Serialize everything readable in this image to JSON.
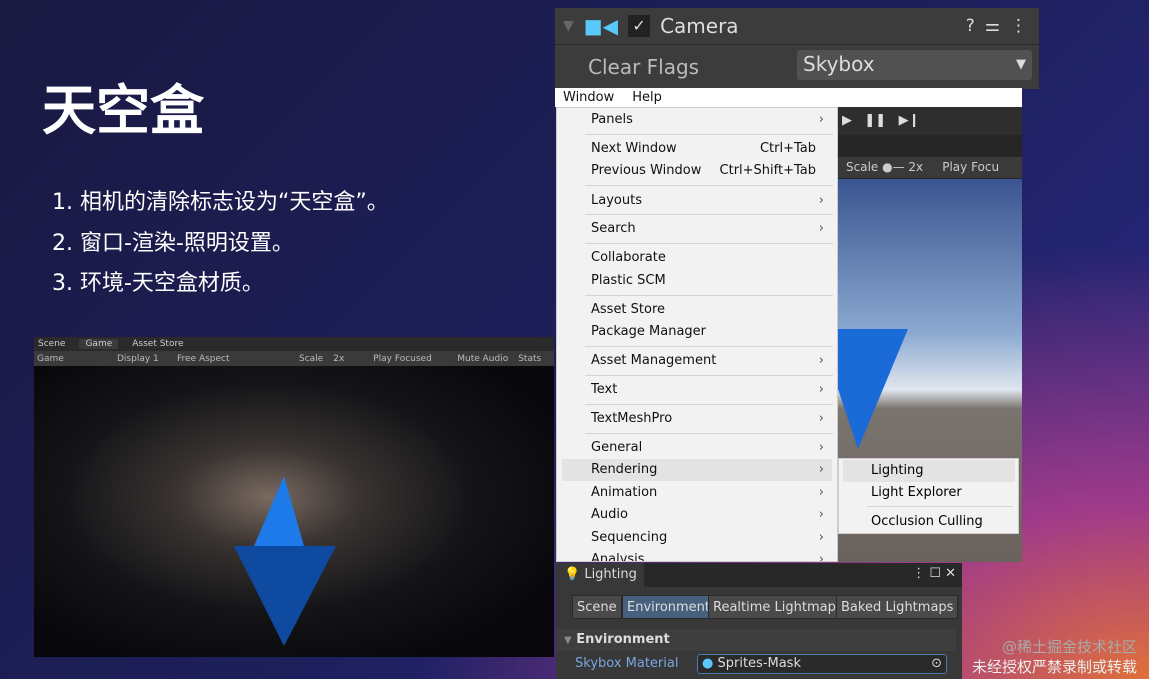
{
  "slide": {
    "title": "天空盒",
    "steps": [
      "1. 相机的清除标志设为“天空盒”。",
      "2. 窗口-渲染-照明设置。",
      "3. 环境-天空盒材质。"
    ]
  },
  "game_view": {
    "tabs": [
      "Scene",
      "Game",
      "Asset Store"
    ],
    "toolbar": [
      "Game",
      "Display 1",
      "Free Aspect",
      "Scale",
      "2x",
      "Play Focused",
      "Mute Audio",
      "Stats"
    ]
  },
  "inspector": {
    "component": "Camera",
    "clear_flags_label": "Clear Flags",
    "clear_flags_value": "Skybox",
    "accent": "#5ac8fa"
  },
  "menubar": [
    "Window",
    "Help"
  ],
  "editor_bg": {
    "scale": "Scale",
    "zoom": "2x",
    "play": "Play Focu"
  },
  "menu": [
    {
      "label": "Panels",
      "arrow": true
    },
    {
      "label": "Next Window",
      "shortcut": "Ctrl+Tab"
    },
    {
      "label": "Previous Window",
      "shortcut": "Ctrl+Shift+Tab"
    },
    {
      "label": "Layouts",
      "arrow": true
    },
    {
      "label": "Search",
      "arrow": true
    },
    {
      "label": "Collaborate"
    },
    {
      "label": "Plastic SCM"
    },
    {
      "label": "Asset Store"
    },
    {
      "label": "Package Manager"
    },
    {
      "label": "Asset Management",
      "arrow": true
    },
    {
      "label": "Text",
      "arrow": true
    },
    {
      "label": "TextMeshPro",
      "arrow": true
    },
    {
      "label": "General",
      "arrow": true
    },
    {
      "label": "Rendering",
      "arrow": true
    },
    {
      "label": "Animation",
      "arrow": true
    },
    {
      "label": "Audio",
      "arrow": true
    },
    {
      "label": "Sequencing",
      "arrow": true
    },
    {
      "label": "Analysis",
      "arrow": true
    }
  ],
  "submenu": [
    "Lighting",
    "Light Explorer",
    "Occlusion Culling"
  ],
  "lighting": {
    "title": "Lighting",
    "tabs": [
      "Scene",
      "Environment",
      "Realtime Lightmaps",
      "Baked Lightmaps"
    ],
    "section": "Environment",
    "field_label": "Skybox Material",
    "field_value": "Sprites-Mask"
  },
  "watermark": [
    "@稀土掘金技术社区",
    "未经授权严禁录制或转载"
  ]
}
